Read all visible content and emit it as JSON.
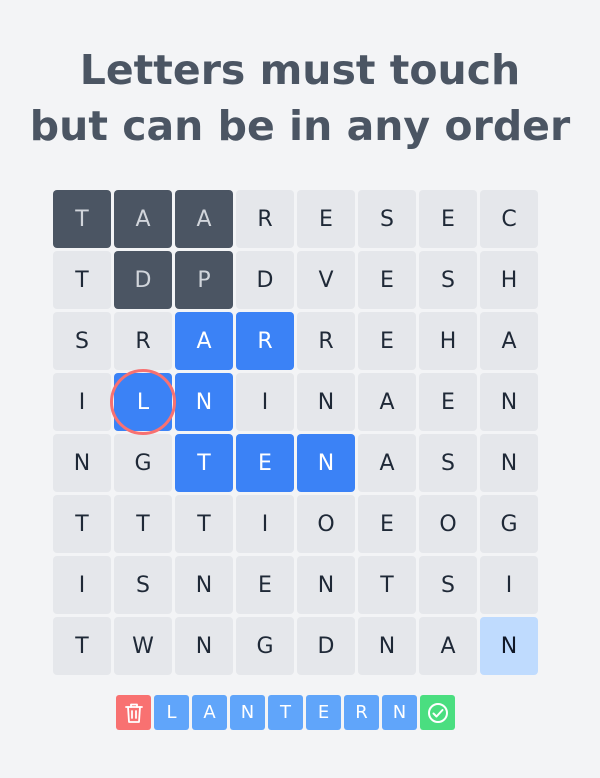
{
  "instruction": {
    "line1": "Letters must touch",
    "line2": "but can be in any order"
  },
  "grid": {
    "rows": [
      [
        "T",
        "A",
        "A",
        "R",
        "E",
        "S",
        "E",
        "C"
      ],
      [
        "T",
        "D",
        "P",
        "D",
        "V",
        "E",
        "S",
        "H"
      ],
      [
        "S",
        "R",
        "A",
        "R",
        "R",
        "E",
        "H",
        "A"
      ],
      [
        "I",
        "L",
        "N",
        "I",
        "N",
        "A",
        "E",
        "N"
      ],
      [
        "N",
        "G",
        "T",
        "E",
        "N",
        "A",
        "S",
        "N"
      ],
      [
        "T",
        "T",
        "T",
        "I",
        "O",
        "E",
        "O",
        "G"
      ],
      [
        "I",
        "S",
        "N",
        "E",
        "N",
        "T",
        "S",
        "I"
      ],
      [
        "T",
        "W",
        "N",
        "G",
        "D",
        "N",
        "A",
        "N"
      ]
    ],
    "found_cells": [
      [
        0,
        0
      ],
      [
        0,
        1
      ],
      [
        0,
        2
      ],
      [
        1,
        1
      ],
      [
        1,
        2
      ]
    ],
    "selected_cells": [
      [
        2,
        2
      ],
      [
        2,
        3
      ],
      [
        3,
        1
      ],
      [
        3,
        2
      ],
      [
        4,
        2
      ],
      [
        4,
        3
      ],
      [
        4,
        4
      ]
    ],
    "hint_cells": [
      [
        7,
        7
      ]
    ],
    "ring_cell": [
      3,
      1
    ]
  },
  "word_bar": {
    "letters": [
      "L",
      "A",
      "N",
      "T",
      "E",
      "R",
      "N"
    ],
    "trash_icon": "trash-icon",
    "submit_icon": "check-circle-icon"
  },
  "colors": {
    "background": "#f3f4f6",
    "cell": "#e5e7eb",
    "found": "#4b5563",
    "selected": "#3b82f6",
    "hint": "#bfdbfe",
    "ring": "#f87171",
    "chip": "#60a5fa",
    "delete": "#f87171",
    "submit": "#4ade80"
  }
}
